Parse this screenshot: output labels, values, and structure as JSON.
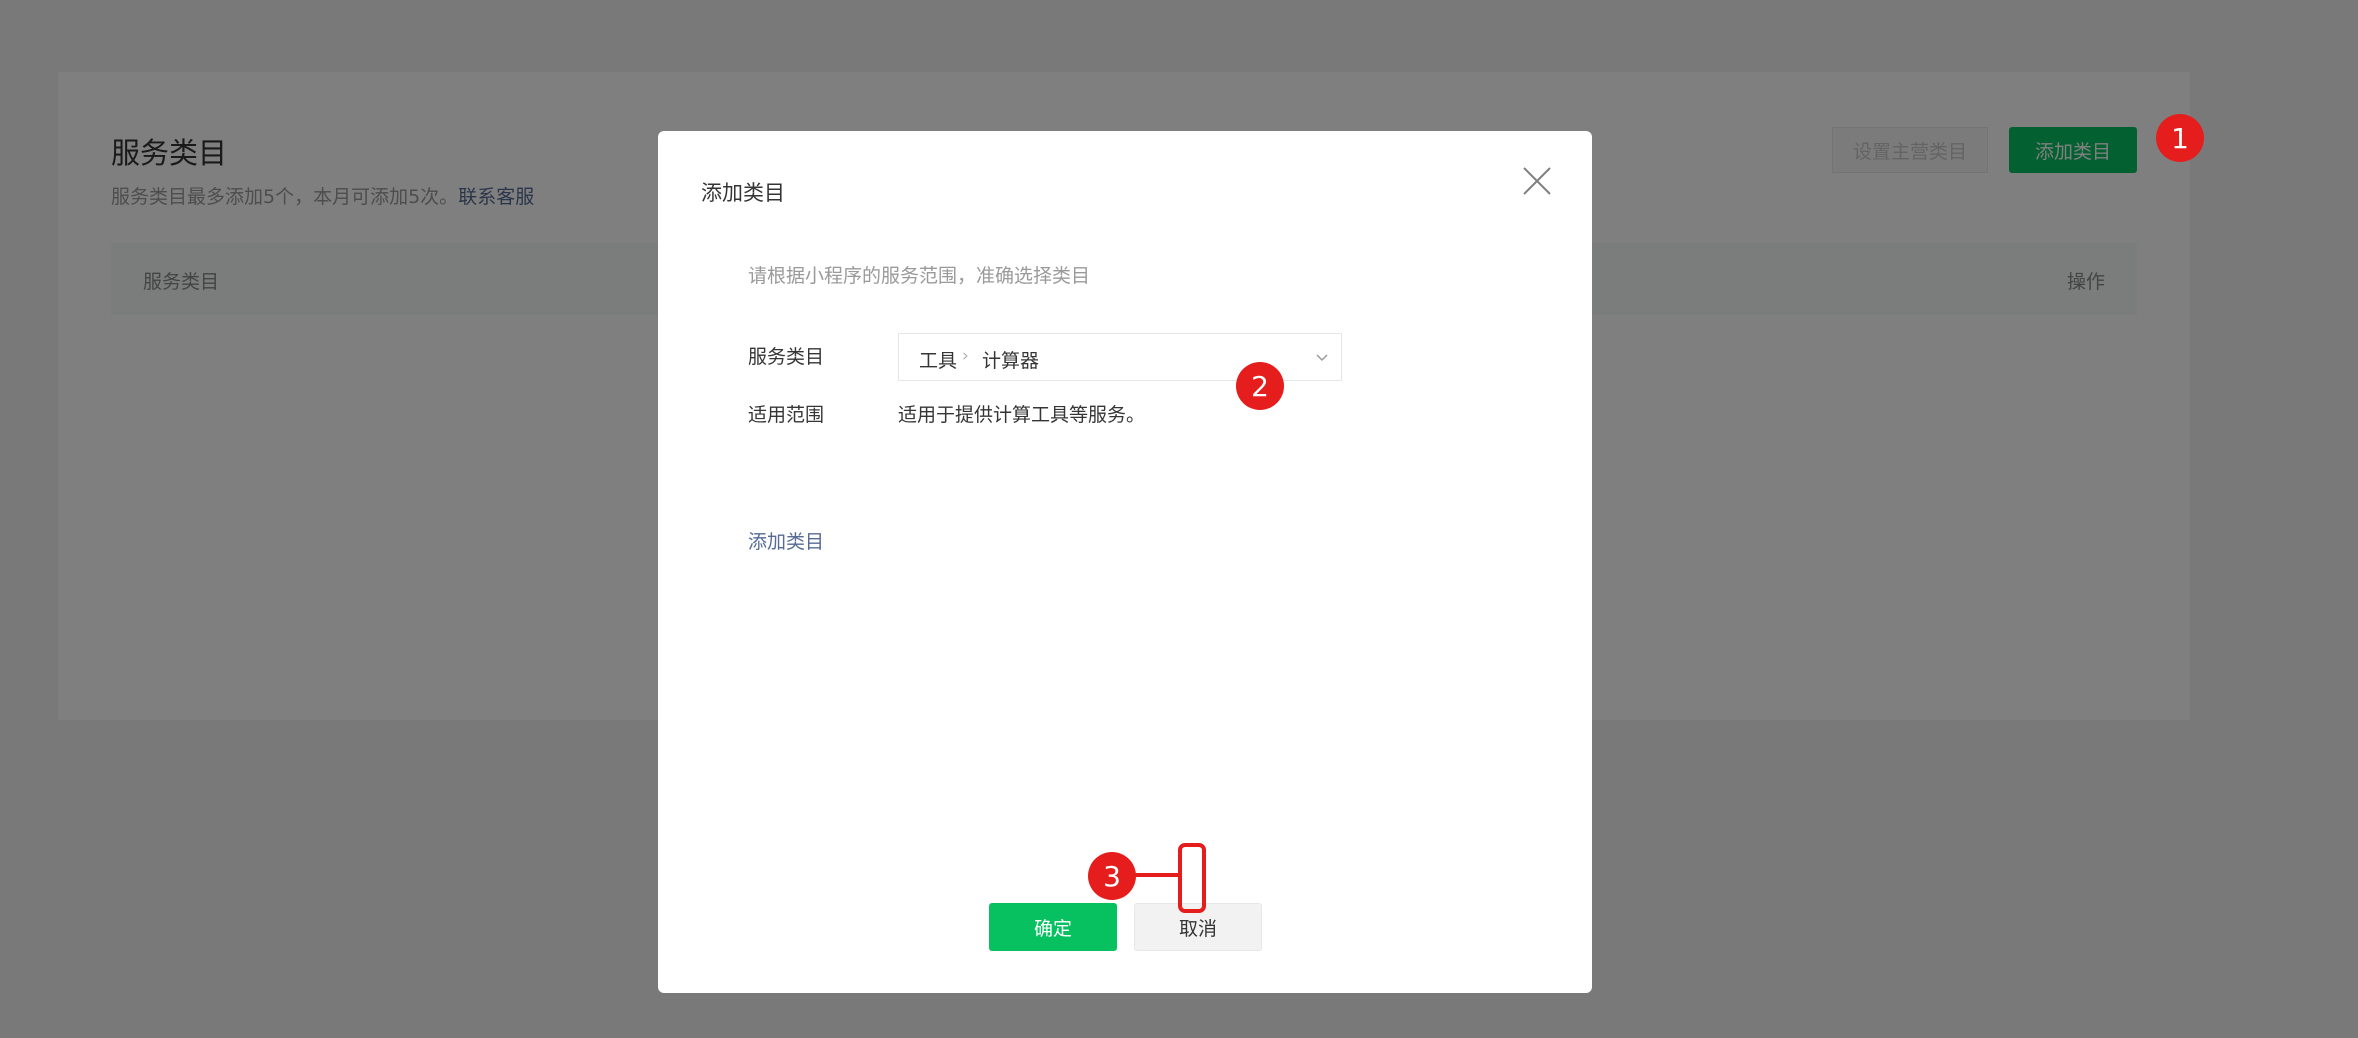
{
  "page": {
    "title": "服务类目",
    "subtitle": "服务类目最多添加5个，本月可添加5次。",
    "subtitle_link": "联系客服",
    "set_primary_button": "设置主营类目",
    "add_category_button": "添加类目",
    "table_headers": [
      "服务类目",
      "操作"
    ]
  },
  "modal": {
    "title": "添加类目",
    "hint": "请根据小程序的服务范围，准确选择类目",
    "category_label": "服务类目",
    "selected_category": [
      "工具",
      "计算器"
    ],
    "category_separator": "›",
    "scope_label": "适用范围",
    "scope_text": "适用于提供计算工具等服务。",
    "add_link": "添加类目",
    "confirm_button": "确定",
    "cancel_button": "取消"
  },
  "annotations": {
    "step1": "1",
    "step2": "2",
    "step3": "3"
  },
  "icons": {
    "close": "close-icon",
    "select_caret": "chevron-down-icon"
  },
  "colors": {
    "primary_green": "#07c160",
    "link_blue": "#576b95",
    "marker_red": "#e51d1d"
  }
}
